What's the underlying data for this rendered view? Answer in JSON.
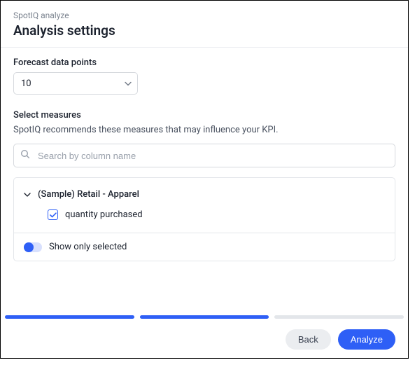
{
  "header": {
    "eyebrow": "SpotIQ analyze",
    "title": "Analysis settings"
  },
  "forecast": {
    "label": "Forecast data points",
    "value": "10"
  },
  "measures": {
    "label": "Select measures",
    "subtext": "SpotIQ recommends these measures that may influence your KPI.",
    "search_placeholder": "Search by column name",
    "group_title": "(Sample) Retail - Apparel",
    "item_label": "quantity purchased",
    "toggle_label": "Show only selected"
  },
  "footer": {
    "back": "Back",
    "analyze": "Analyze"
  }
}
